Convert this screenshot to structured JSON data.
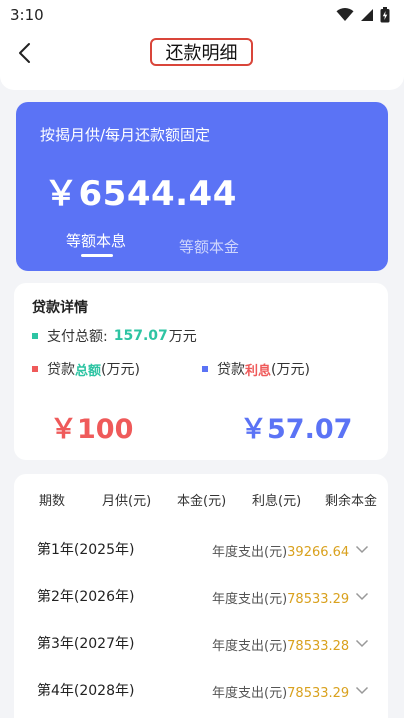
{
  "status_bar": {
    "time": "3:10"
  },
  "nav": {
    "title": "还款明细"
  },
  "hero": {
    "subtitle": "按揭月供/每月还款额固定",
    "amount": "￥6544.44",
    "tabs": [
      {
        "label": "等额本息",
        "active": true
      },
      {
        "label": "等额本金",
        "active": false
      }
    ]
  },
  "loan": {
    "title": "贷款详情",
    "total_payment_label": "支付总额:",
    "total_payment_value": "157.07",
    "total_payment_unit": "万元",
    "principal_prefix": "贷款",
    "principal_highlight": "总额",
    "principal_unit": "(万元)",
    "interest_prefix": "贷款",
    "interest_highlight": "利息",
    "interest_unit": "(万元)",
    "principal_value": "￥100",
    "interest_value": "￥57.07"
  },
  "table": {
    "headers": [
      "期数",
      "月供(元)",
      "本金(元)",
      "利息(元)",
      "剩余本金"
    ],
    "rows": [
      {
        "label": "第1年(2025年)",
        "prefix": "年度支出(元)",
        "value": "39266.64"
      },
      {
        "label": "第2年(2026年)",
        "prefix": "年度支出(元)",
        "value": "78533.29"
      },
      {
        "label": "第3年(2027年)",
        "prefix": "年度支出(元)",
        "value": "78533.28"
      },
      {
        "label": "第4年(2028年)",
        "prefix": "年度支出(元)",
        "value": "78533.29"
      }
    ]
  },
  "colors": {
    "primary_blue": "#5b73f5",
    "green": "#2ec4a3",
    "red": "#ef5a5a",
    "gold": "#d9a11e"
  },
  "icons": [
    "wifi-icon",
    "signal-icon",
    "battery-icon",
    "back-arrow-icon",
    "chevron-down-icon"
  ]
}
